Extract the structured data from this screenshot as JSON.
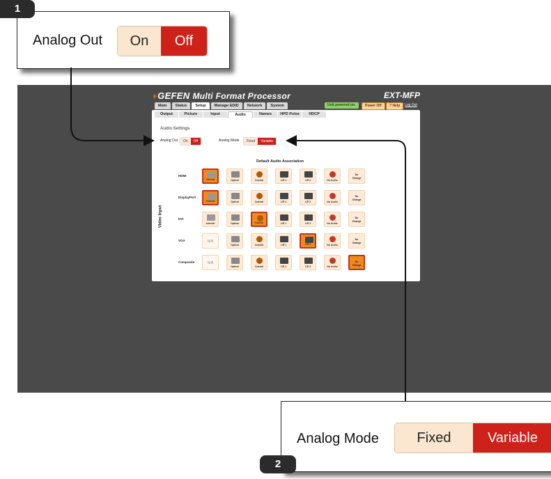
{
  "callout1": {
    "badge": "1",
    "label": "Analog Out",
    "on": "On",
    "off": "Off"
  },
  "callout2": {
    "badge": "2",
    "label": "Analog Mode",
    "fixed": "Fixed",
    "variable": "Variable"
  },
  "app": {
    "brand": "GEFEN",
    "title": "Multi Format Processor",
    "model": "EXT-MFP",
    "main_tabs": [
      "Main",
      "Status",
      "Setup",
      "Manage EDID",
      "Network",
      "System"
    ],
    "active_main_tab": "Setup",
    "status": "Unit powered on.",
    "power_button": "Power Off",
    "help_button": "? Help",
    "logout": "Log Out",
    "sub_tabs": [
      "Output",
      "Picture",
      "Input",
      "Audio",
      "Names",
      "HPD Pulse",
      "HDCP"
    ],
    "active_sub_tab": "Audio",
    "section_title": "Audio Settings",
    "analog_out_label": "Analog Out",
    "analog_out_on": "On",
    "analog_out_off": "Off",
    "analog_out_selected": "Off",
    "analog_mode_label": "Analog Mode",
    "analog_mode_fixed": "Fixed",
    "analog_mode_variable": "Variable",
    "analog_mode_selected": "Variable",
    "table_title": "Default Audio Association",
    "axis_label": "Video Input",
    "columns": [
      "Internal",
      "Optical",
      "Coaxial",
      "L/R 1",
      "L/R 2",
      "No Audio",
      "No Change"
    ],
    "rows": [
      {
        "label": "HDMI",
        "cells": [
          "Internal",
          "Optical",
          "Coaxial",
          "L/R 1",
          "L/R 2",
          "No Audio",
          "No Change"
        ],
        "selected": 0
      },
      {
        "label": "DisplayPort",
        "cells": [
          "Internal",
          "Optical",
          "Coaxial",
          "L/R 1",
          "L/R 2",
          "No Audio",
          "No Change"
        ],
        "selected": 0
      },
      {
        "label": "DVI",
        "cells": [
          "Internal",
          "Optical",
          "Coaxial",
          "L/R 1",
          "L/R 2",
          "No Audio",
          "No Change"
        ],
        "selected": 2
      },
      {
        "label": "VGA",
        "cells": [
          "N/A",
          "Optical",
          "Coaxial",
          "L/R 1",
          "L/R 2",
          "No Audio",
          "No Change"
        ],
        "selected": 4
      },
      {
        "label": "Composite",
        "cells": [
          "N/A",
          "Optical",
          "Coaxial",
          "L/R 1",
          "L/R 2",
          "No Audio",
          "No Change"
        ],
        "selected": 6
      }
    ]
  },
  "colors": {
    "accent_red": "#c8201a",
    "cell_bg": "#fdebd7",
    "selected_cell": "#f08a1e",
    "panel_gray": "#4a4a4a",
    "brand_orange": "#f07800",
    "status_green": "#8fd06a"
  }
}
